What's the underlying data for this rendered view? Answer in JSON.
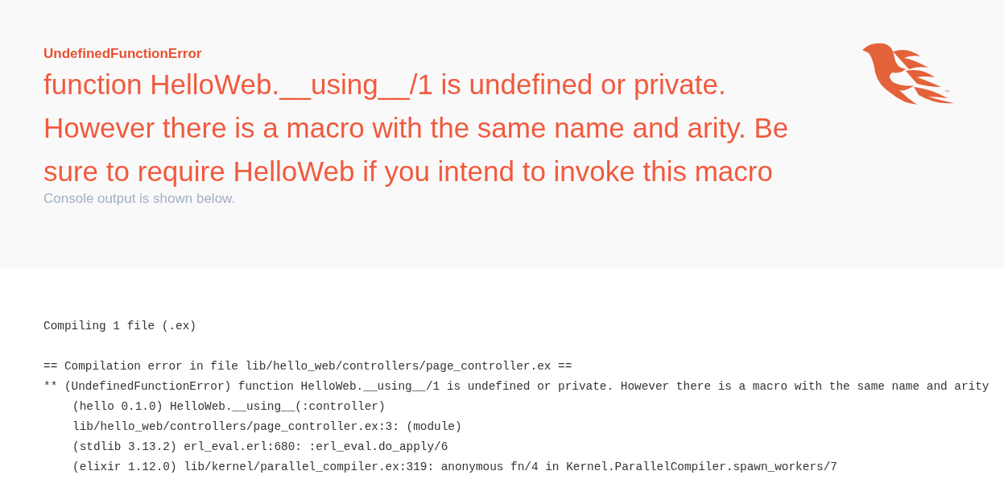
{
  "header": {
    "exception": "UndefinedFunctionError",
    "message": "function HelloWeb.__using__/1 is undefined or private. However there is a macro with the same name and arity. Be sure to require HelloWeb if you intend to invoke this macro",
    "subtitle": "Console output is shown below.",
    "logo": {
      "trademark": "™"
    }
  },
  "console": [
    {
      "kind": "status",
      "text": "Compiling 1 file (.ex)"
    },
    {
      "kind": "error",
      "text": "== Compilation error in file lib/hello_web/controllers/page_controller.ex =="
    },
    {
      "kind": "error",
      "text": "** (UndefinedFunctionError) function HelloWeb.__using__/1 is undefined or private. However there is a macro with the same name and arity"
    },
    {
      "kind": "frame",
      "text": "(hello 0.1.0) HelloWeb.__using__(:controller)"
    },
    {
      "kind": "frame",
      "text": "lib/hello_web/controllers/page_controller.ex:3: (module)"
    },
    {
      "kind": "frame",
      "text": "(stdlib 3.13.2) erl_eval.erl:680: :erl_eval.do_apply/6"
    },
    {
      "kind": "frame",
      "text": "(elixir 1.12.0) lib/kernel/parallel_compiler.ex:319: anonymous fn/4 in Kernel.ParallelCompiler.spawn_workers/7"
    }
  ]
}
